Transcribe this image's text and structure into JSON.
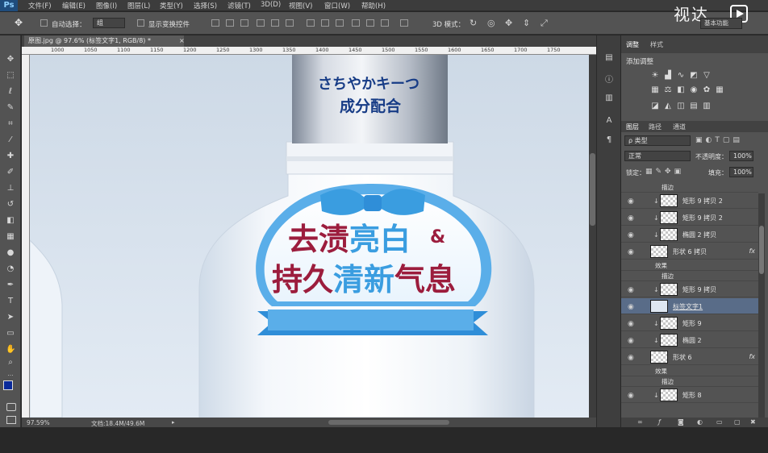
{
  "menubar": {
    "logo": "Ps",
    "items": [
      "文件(F)",
      "编辑(E)",
      "图像(I)",
      "图层(L)",
      "类型(Y)",
      "选择(S)",
      "滤镜(T)",
      "3D(D)",
      "视图(V)",
      "窗口(W)",
      "帮助(H)"
    ]
  },
  "options": {
    "auto_select_label": "自动选择：",
    "auto_select_value": "组",
    "show_transform_label": "显示变换控件",
    "mode_3d_label": "3D 模式：",
    "workspace_value": "基本功能"
  },
  "brand": {
    "text": "视达"
  },
  "document": {
    "tab_title": "原图.jpg @ 97.6% (标签文字1, RGB/8) *",
    "ruler_ticks": [
      "1000",
      "1050",
      "1100",
      "1150",
      "1200",
      "1250",
      "1300",
      "1350",
      "1400",
      "1450",
      "1500",
      "1550",
      "1600",
      "1650",
      "1700",
      "1750"
    ],
    "status_zoom": "97.59%",
    "status_doc": "文档:18.4M/49.6M"
  },
  "artwork": {
    "cap_line1": "さちやかキーつ",
    "cap_line2": "成分配合",
    "label_line1_part1": "去渍",
    "label_line1_part2": "亮白",
    "label_line1_amp": "&",
    "label_line2_part1": "持久",
    "label_line2_part2": "清新",
    "label_line2_part3": "气息",
    "colors": {
      "wine": "#9c1d3d",
      "sky": "#3a9de0",
      "navy": "#173c86",
      "badge": "#5aaee9",
      "ribbon": "#2f8ed8"
    }
  },
  "panel": {
    "adj_tab": "调整",
    "styles_tab": "样式",
    "adj_title": "添加调整",
    "layers_tab": "图层",
    "paths_tab": "路径",
    "channels_tab": "通道",
    "filter_type": "ρ 类型",
    "blend_mode": "正常",
    "opacity_label": "不透明度：",
    "opacity_value": "100%",
    "lock_label": "锁定：",
    "fill_label": "填充：",
    "fill_value": "100%"
  },
  "layers": [
    {
      "kind": "sub",
      "label": "描边"
    },
    {
      "kind": "layer",
      "name": "矩形 9 拷贝 2",
      "clip": true
    },
    {
      "kind": "layer",
      "name": "矩形 9 拷贝 2",
      "clip": true
    },
    {
      "kind": "layer",
      "name": "椭圆 2 拷贝",
      "clip": true
    },
    {
      "kind": "layer",
      "name": "形状 6 拷贝",
      "fx": "fx"
    },
    {
      "kind": "sub",
      "label": "效果"
    },
    {
      "kind": "sub",
      "label": "描边"
    },
    {
      "kind": "layer",
      "name": "矩形 9 拷贝",
      "clip": true
    },
    {
      "kind": "layer",
      "name": "标签文字1",
      "selected": true
    },
    {
      "kind": "layer",
      "name": "矩形 9",
      "clip": true
    },
    {
      "kind": "layer",
      "name": "椭圆 2",
      "clip": true
    },
    {
      "kind": "layer",
      "name": "形状 6",
      "fx": "fx"
    },
    {
      "kind": "sub",
      "label": "效果"
    },
    {
      "kind": "sub",
      "label": "描边"
    },
    {
      "kind": "layer",
      "name": "矩形 8",
      "clip": true
    }
  ]
}
